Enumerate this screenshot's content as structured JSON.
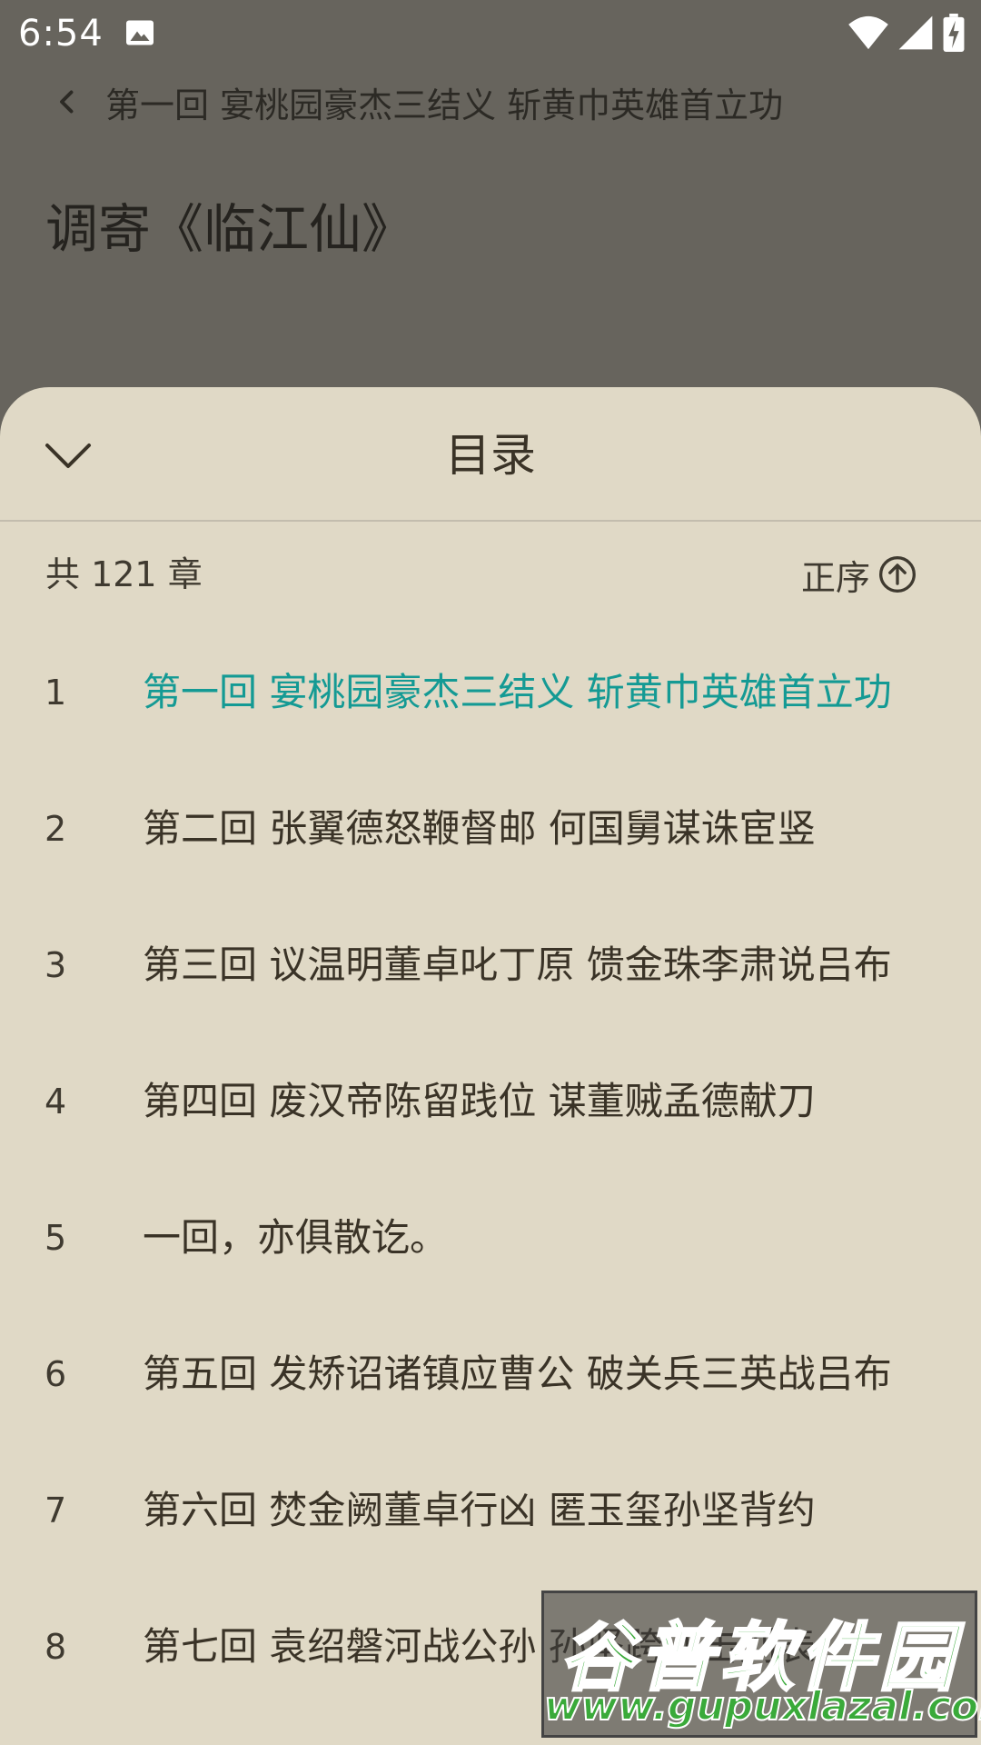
{
  "status_bar": {
    "time": "6:54",
    "icons": [
      "image-icon",
      "wifi-icon",
      "signal-icon",
      "battery-charging-icon"
    ]
  },
  "reader": {
    "chapter_title": "第一回 宴桃园豪杰三结义 斩黄巾英雄首立功",
    "section_title": "调寄《临江仙》"
  },
  "sheet": {
    "title": "目录",
    "chapter_count": "共 121 章",
    "sort_label": "正序",
    "chapters": [
      {
        "num": "1",
        "name": "第一回 宴桃园豪杰三结义 斩黄巾英雄首立功"
      },
      {
        "num": "2",
        "name": "第二回 张翼德怒鞭督邮 何国舅谋诛宦竖"
      },
      {
        "num": "3",
        "name": "第三回 议温明董卓叱丁原 馈金珠李肃说吕布"
      },
      {
        "num": "4",
        "name": "第四回 废汉帝陈留践位 谋董贼孟德献刀"
      },
      {
        "num": "5",
        "name": "一回，亦俱散讫。"
      },
      {
        "num": "6",
        "name": "第五回 发矫诏诸镇应曹公 破关兵三英战吕布"
      },
      {
        "num": "7",
        "name": "第六回 焚金阙董卓行凶 匿玉玺孙坚背约"
      },
      {
        "num": "8",
        "name": "第七回 袁绍磐河战公孙 孙坚跨江击刘表"
      }
    ]
  },
  "colors": {
    "sheet_background": "#e0d9c6",
    "overlay": "#67645d",
    "active_chapter": "#149a94",
    "text": "#3a3327"
  },
  "watermark": {
    "name": "谷普软件园",
    "url": "www.gupuxlazal.com"
  }
}
